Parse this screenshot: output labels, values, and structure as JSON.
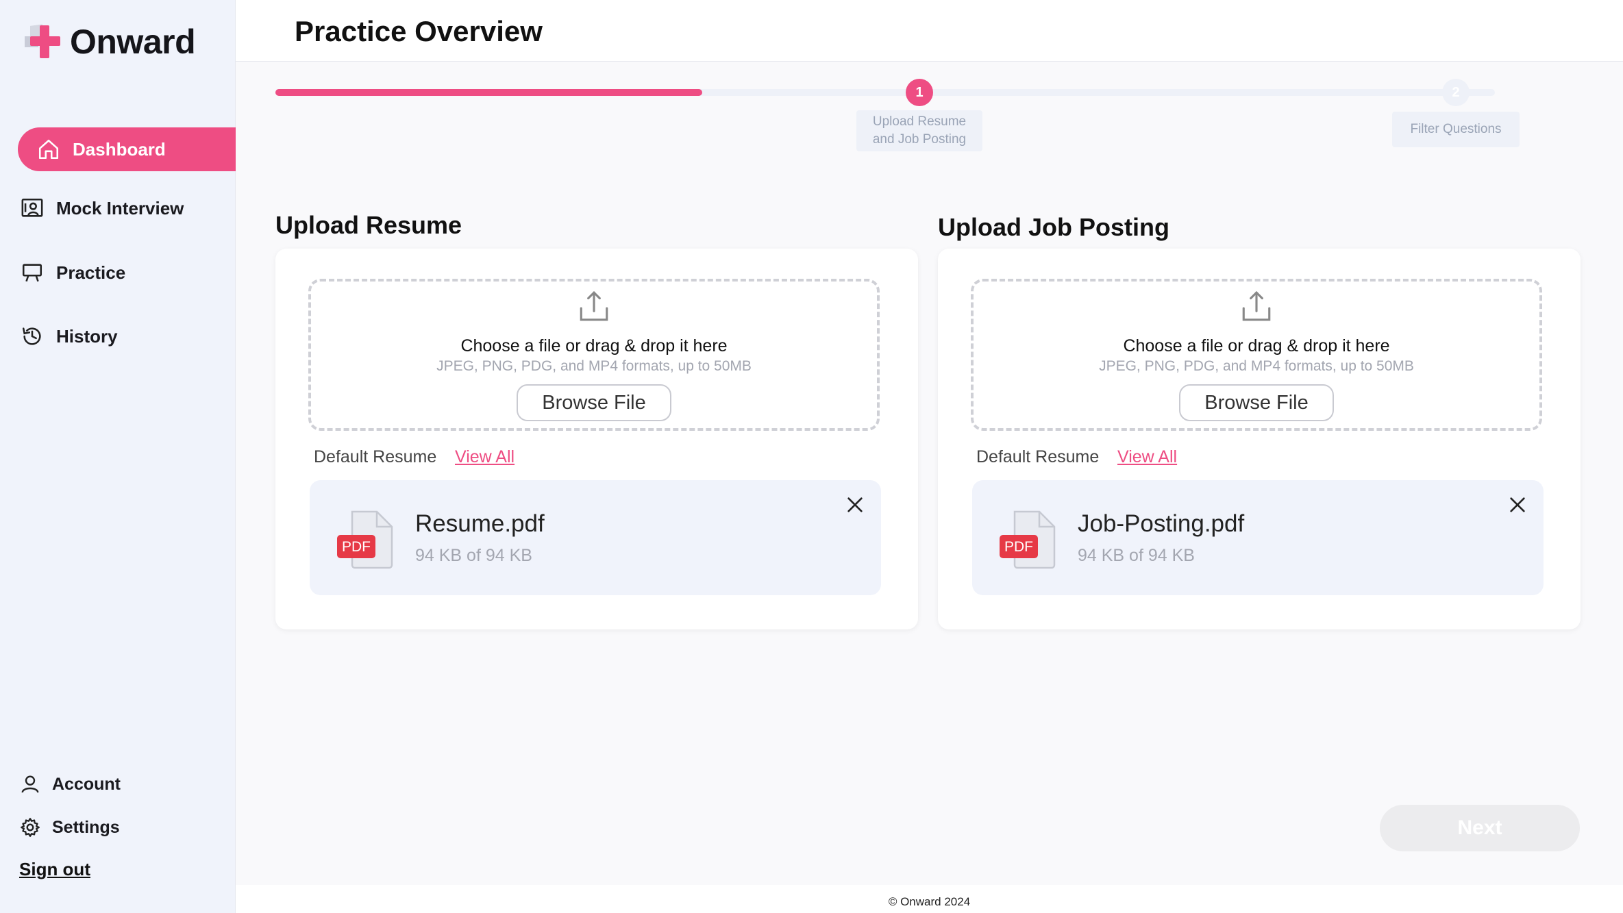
{
  "app": {
    "name": "Onward",
    "accent": "#ee4d83"
  },
  "sidebar": {
    "items": [
      {
        "label": "Dashboard",
        "icon": "home-icon",
        "active": true
      },
      {
        "label": "Mock Interview",
        "icon": "mock-interview-icon"
      },
      {
        "label": "Practice",
        "icon": "presentation-icon"
      },
      {
        "label": "History",
        "icon": "history-icon"
      }
    ],
    "bottom": [
      {
        "label": "Account",
        "icon": "user-icon"
      },
      {
        "label": "Settings",
        "icon": "gear-icon"
      }
    ],
    "signout": "Sign out"
  },
  "header": {
    "title": "Practice Overview"
  },
  "stepper": {
    "progress": 0.35,
    "steps": [
      {
        "number": "1",
        "label": "Upload Resume and Job Posting",
        "active": true
      },
      {
        "number": "2",
        "label": "Filter Questions",
        "active": false
      }
    ]
  },
  "resume": {
    "title": "Upload Resume",
    "dz_title": "Choose a file or drag & drop it here",
    "dz_sub": "JPEG, PNG, PDG, and MP4 formats, up to 50MB",
    "browse": "Browse File",
    "default_label": "Default Resume",
    "view_all": "View All",
    "file": {
      "badge": "PDF",
      "name": "Resume.pdf",
      "size": "94 KB of 94 KB"
    }
  },
  "job": {
    "title": "Upload Job Posting",
    "dz_title": "Choose a file or drag & drop it here",
    "dz_sub": "JPEG, PNG, PDG, and MP4 formats, up to 50MB",
    "browse": "Browse File",
    "default_label": "Default Resume",
    "view_all": "View All",
    "file": {
      "badge": "PDF",
      "name": "Job-Posting.pdf",
      "size": "94 KB of 94 KB"
    }
  },
  "next": "Next",
  "footer": "© Onward 2024"
}
